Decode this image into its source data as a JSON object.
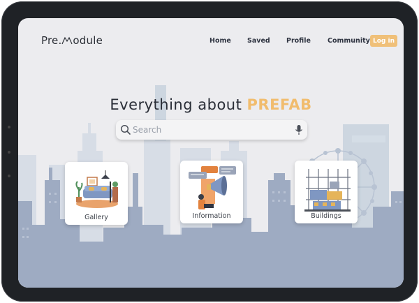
{
  "app": {
    "logo_prefix": "Pre.",
    "logo_suffix": "odule"
  },
  "nav": {
    "home": "Home",
    "saved": "Saved",
    "profile": "Profile",
    "community": "Community",
    "login": "Log in"
  },
  "hero": {
    "title_prefix": "Everything about ",
    "title_accent": "PREFAB"
  },
  "search": {
    "placeholder": "Search"
  },
  "cards": [
    {
      "label": "Gallery"
    },
    {
      "label": "Information"
    },
    {
      "label": "Buildings"
    }
  ],
  "colors": {
    "accent": "#f1bc6d",
    "login_bg": "#f0c079",
    "background": "#ececef",
    "skyline": "#9aa8c0"
  },
  "icons": {
    "search": "search-icon",
    "mic": "microphone-icon",
    "gallery": "living-room-illustration",
    "information": "megaphone-illustration",
    "buildings": "construction-illustration"
  }
}
